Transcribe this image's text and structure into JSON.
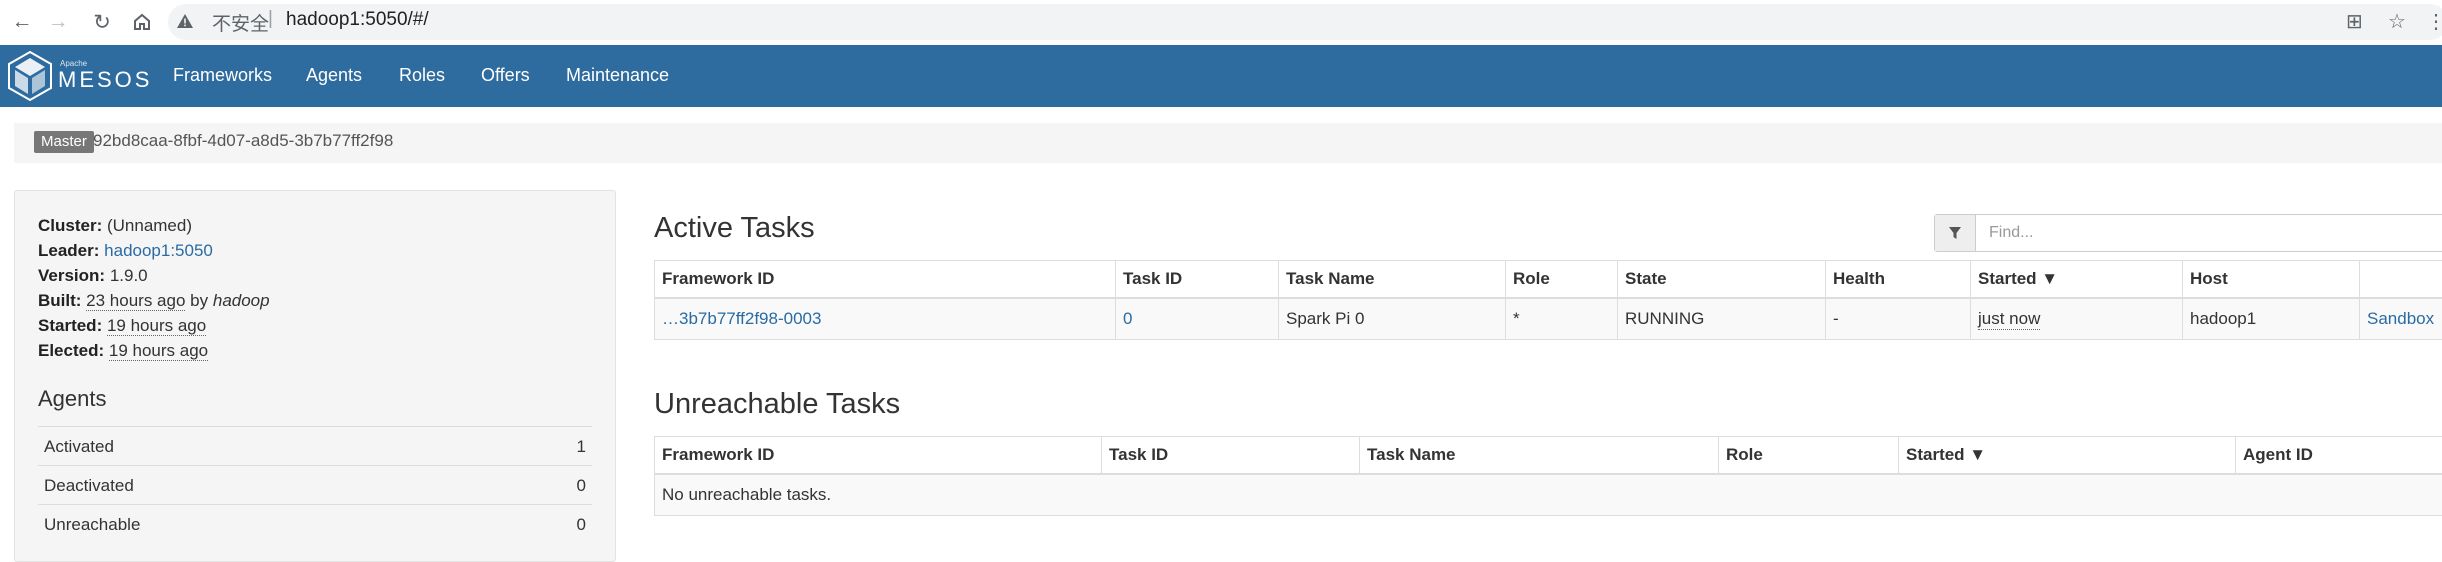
{
  "browser": {
    "security_label": "不安全",
    "separator": "|",
    "url": "hadoop1:5050/#/"
  },
  "navbar": {
    "apache": "Apache",
    "brand": "MESOS",
    "links": [
      "Frameworks",
      "Agents",
      "Roles",
      "Offers",
      "Maintenance"
    ]
  },
  "master": {
    "badge": "Master",
    "id": "92bd8caa-8fbf-4d07-a8d5-3b7b77ff2f98"
  },
  "cluster_info": {
    "cluster_label": "Cluster:",
    "cluster_value": "(Unnamed)",
    "leader_label": "Leader:",
    "leader_value": "hadoop1:5050",
    "version_label": "Version:",
    "version_value": "1.9.0",
    "built_label": "Built:",
    "built_when": "23 hours ago",
    "built_by": "by",
    "built_user": "hadoop",
    "started_label": "Started:",
    "started_value": "19 hours ago",
    "elected_label": "Elected:",
    "elected_value": "19 hours ago"
  },
  "agents": {
    "title": "Agents",
    "rows": [
      {
        "label": "Activated",
        "value": "1"
      },
      {
        "label": "Deactivated",
        "value": "0"
      },
      {
        "label": "Unreachable",
        "value": "0"
      }
    ]
  },
  "active_tasks": {
    "title": "Active Tasks",
    "filter_placeholder": "Find...",
    "headers": [
      "Framework ID",
      "Task ID",
      "Task Name",
      "Role",
      "State",
      "Health",
      "Started ▼",
      "Host",
      ""
    ],
    "row": {
      "framework_id": "…3b7b77ff2f98-0003",
      "task_id": "0",
      "task_name": "Spark Pi 0",
      "role": "*",
      "state": "RUNNING",
      "health": "-",
      "started": "just now",
      "host": "hadoop1",
      "sandbox": "Sandbox"
    }
  },
  "unreachable_tasks": {
    "title": "Unreachable Tasks",
    "headers": [
      "Framework ID",
      "Task ID",
      "Task Name",
      "Role",
      "Started ▼",
      "Agent ID"
    ],
    "empty": "No unreachable tasks."
  }
}
